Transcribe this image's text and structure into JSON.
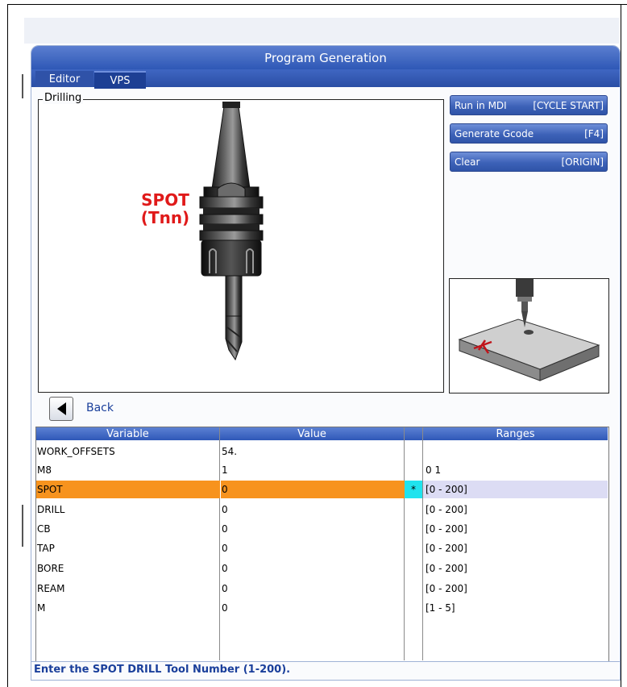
{
  "window": {
    "title": "Program Generation"
  },
  "tabs": [
    {
      "label": "Editor"
    },
    {
      "label": "VPS"
    }
  ],
  "group": {
    "title": "Drilling"
  },
  "illustration": {
    "line1": "SPOT",
    "line2": "(Tnn)"
  },
  "buttons": [
    {
      "label": "Run in MDI",
      "key": "[CYCLE START]"
    },
    {
      "label": "Generate Gcode",
      "key": "[F4]"
    },
    {
      "label": "Clear",
      "key": "[ORIGIN]"
    }
  ],
  "back": {
    "label": "Back"
  },
  "table": {
    "headers": {
      "variable": "Variable",
      "value": "Value",
      "ranges": "Ranges"
    },
    "rows": [
      {
        "variable": "WORK_OFFSETS",
        "value": "54.",
        "marker": "",
        "range": ""
      },
      {
        "variable": "M8",
        "value": "1",
        "marker": "",
        "range": "0 1"
      },
      {
        "variable": "SPOT",
        "value": "0",
        "marker": "*",
        "range": "[0 - 200]"
      },
      {
        "variable": "DRILL",
        "value": "0",
        "marker": "",
        "range": "[0 - 200]"
      },
      {
        "variable": "CB",
        "value": "0",
        "marker": "",
        "range": "[0 - 200]"
      },
      {
        "variable": "TAP",
        "value": "0",
        "marker": "",
        "range": "[0 - 200]"
      },
      {
        "variable": "BORE",
        "value": "0",
        "marker": "",
        "range": "[0 - 200]"
      },
      {
        "variable": "REAM",
        "value": "0",
        "marker": "",
        "range": "[0 - 200]"
      },
      {
        "variable": "M",
        "value": "0",
        "marker": "",
        "range": "[1 - 5]"
      }
    ]
  },
  "status": {
    "message": "Enter the SPOT DRILL Tool Number (1-200)."
  },
  "colors": {
    "accent": "#2e58b6",
    "selected_row": "#f7931e",
    "marker_cell": "#20e3ee",
    "spot_label": "#e01a1a"
  }
}
